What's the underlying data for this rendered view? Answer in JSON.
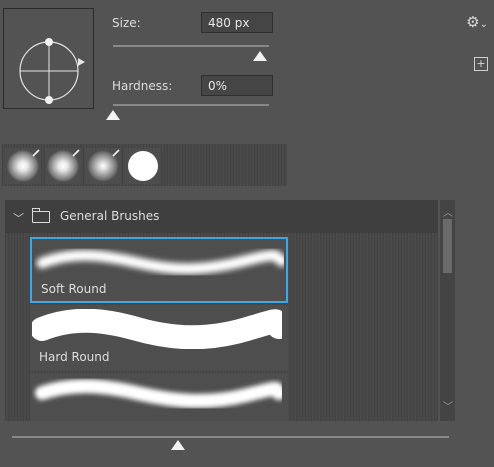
{
  "brush_tip": {
    "size_label": "Size:",
    "size_value": "480 px",
    "size_slider_fraction": 0.94,
    "hardness_label": "Hardness:",
    "hardness_value": "0%",
    "hardness_slider_fraction": 0.0
  },
  "toolbar": {
    "gear_icon": "⚙",
    "gear_caret": "⌄",
    "new_button_glyph": "+"
  },
  "recent_brushes": [
    {
      "type": "soft"
    },
    {
      "type": "soft"
    },
    {
      "type": "soft"
    },
    {
      "type": "hard"
    }
  ],
  "groups": [
    {
      "name": "General Brushes",
      "expanded": true,
      "items": [
        {
          "name": "Soft Round",
          "selected": true
        },
        {
          "name": "Hard Round",
          "selected": false
        },
        {
          "name": "",
          "selected": false
        }
      ]
    }
  ],
  "preview_size_fraction": 0.38,
  "colors": {
    "panel_bg": "#535353",
    "selection": "#3fa7e6",
    "text": "#d6d6d6"
  }
}
